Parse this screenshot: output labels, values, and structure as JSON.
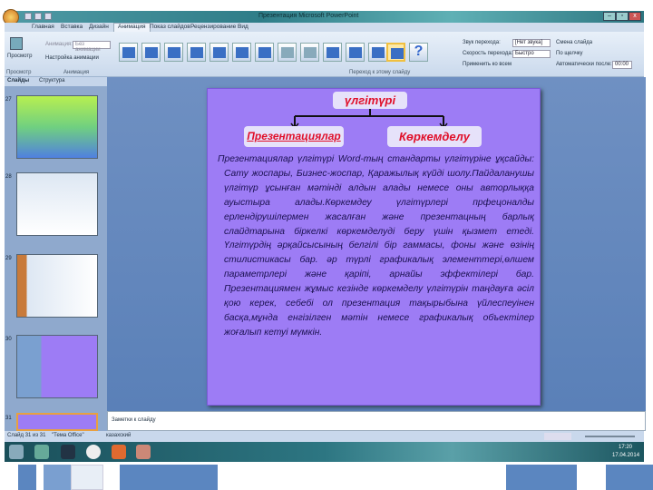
{
  "window": {
    "title": "Презентация Microsoft PowerPoint"
  },
  "tabs": [
    "Главная",
    "Вставка",
    "Дизайн",
    "Анимация",
    "Показ слайдов",
    "Рецензирование",
    "Вид"
  ],
  "ribbon": {
    "preview_label": "Просмотр",
    "preview_group": "Просмотр",
    "animation_label": "Анимация:",
    "animation_value": "Без анимации",
    "custom_animation": "Настройка анимации",
    "animation_group": "Анимация",
    "transitions_group": "Переход к этому слайду",
    "sound_label": "Звук перехода:",
    "sound_value": "[Нет звука]",
    "speed_label": "Скорость перехода:",
    "speed_value": "Быстро",
    "apply_all": "Применить ко всем",
    "advance_label": "Смена слайда",
    "on_click": "По щелчку",
    "auto_after": "Автоматически после:",
    "auto_value": "00:00"
  },
  "pane": {
    "tab_slides": "Слайды",
    "tab_outline": "Структура",
    "slide_numbers": [
      "27",
      "28",
      "29",
      "30",
      "31"
    ]
  },
  "slide": {
    "top_box": "үлгітүрі",
    "left_box": "Презентациялар",
    "right_box": "Көркемделу",
    "body": "Презентациялар үлгітүрі Word-тың стандарты үлгітүріне ұқсайды: Сату жоспары, Бизнес-жоспар, Қаражылық күйді шолу.Пайдаланушы үлгітүр ұсынған мәтінді алдын алады немесе оны авторлыққа ауыстыра алады.Көркемдеу үлгітүрлері прфецоналды ерлендірушілермен жасалған және презентацның барлық слайдтарына біркелкі көркемделуді беру үшін қызмет етеді. Үлгітүрдің әрқайсысының белгілі бір гаммасы, фоны және өзінің стилистикасы бар. әр түрлі графикалық элементтері,өлшем параметрлері және қаріпі, арнайы эффектілері бар. Презентациямен жұмыс кезінде көркемделу үлгітүрін таңдауға әсіл қою керек, себебі ол презентация тақырыбына үйлеспеуінен басқа,мұнда енгізілген мәтін немесе графикалық объектілер жоғалып кетуі мүмкін."
  },
  "notes": {
    "placeholder": "Заметки к слайду"
  },
  "status": {
    "slide": "Слайд 31 из 31",
    "theme": "\"Тема Office\"",
    "lang": "казахский"
  },
  "taskbar": {
    "time": "17:20",
    "date": "17.04.2014"
  },
  "colors": {
    "slide_bg": "#9d7cf5",
    "title_text": "#e0102a"
  }
}
